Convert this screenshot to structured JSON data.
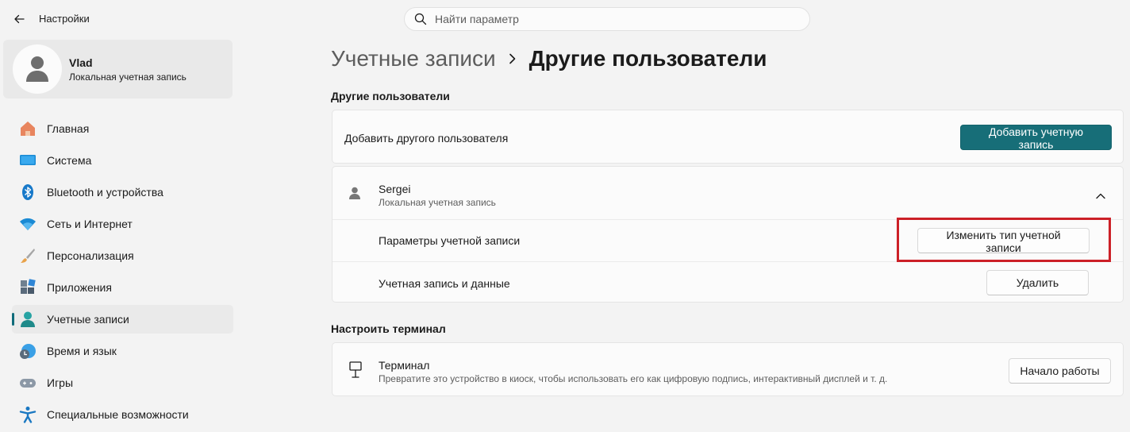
{
  "window": {
    "title": "Настройки"
  },
  "search": {
    "placeholder": "Найти параметр"
  },
  "profile": {
    "name": "Vlad",
    "account_type": "Локальная учетная запись"
  },
  "sidebar": {
    "items": [
      {
        "label": "Главная",
        "icon": "home-icon",
        "active": false
      },
      {
        "label": "Система",
        "icon": "system-icon",
        "active": false
      },
      {
        "label": "Bluetooth и устройства",
        "icon": "bluetooth-icon",
        "active": false
      },
      {
        "label": "Сеть и Интернет",
        "icon": "wifi-icon",
        "active": false
      },
      {
        "label": "Персонализация",
        "icon": "brush-icon",
        "active": false
      },
      {
        "label": "Приложения",
        "icon": "apps-icon",
        "active": false
      },
      {
        "label": "Учетные записи",
        "icon": "accounts-icon",
        "active": true
      },
      {
        "label": "Время и язык",
        "icon": "time-language-icon",
        "active": false
      },
      {
        "label": "Игры",
        "icon": "gamepad-icon",
        "active": false
      },
      {
        "label": "Специальные возможности",
        "icon": "accessibility-icon",
        "active": false
      }
    ]
  },
  "breadcrumb": {
    "parent": "Учетные записи",
    "current": "Другие пользователи"
  },
  "other_users": {
    "section_title": "Другие пользователи",
    "add_user_label": "Добавить другого пользователя",
    "add_account_button": "Добавить учетную запись",
    "user": {
      "name": "Sergei",
      "account_type": "Локальная учетная запись",
      "settings_label": "Параметры учетной записи",
      "change_type_button": "Изменить тип учетной записи",
      "data_label": "Учетная запись и данные",
      "delete_button": "Удалить"
    }
  },
  "kiosk": {
    "section_title": "Настроить терминал",
    "title": "Терминал",
    "description": "Превратите это устройство в киоск, чтобы использовать его как цифровую подпись, интерактивный дисплей и т. д.",
    "start_button": "Начало работы"
  },
  "colors": {
    "accent": "#176e78",
    "highlight": "#cc2027",
    "background": "#f3f3f3",
    "card": "#fbfbfb"
  }
}
